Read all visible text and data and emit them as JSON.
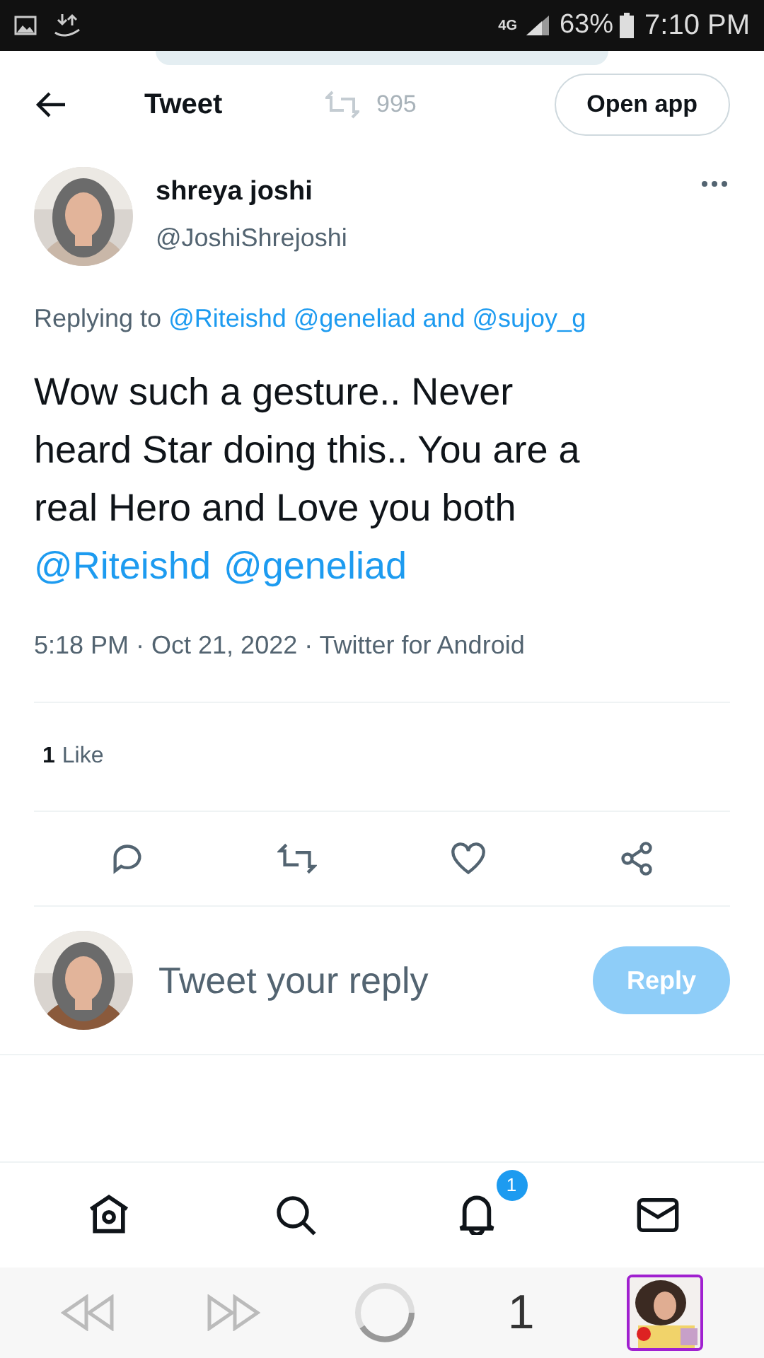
{
  "status_bar": {
    "network": "4G",
    "battery": "63%",
    "time": "7:10 PM"
  },
  "header": {
    "title": "Tweet",
    "faded_count": "995",
    "open_app": "Open app"
  },
  "tweet": {
    "name": "shreya joshi",
    "handle": "@JoshiShrejoshi",
    "replying_label": "Replying to",
    "replying_to": [
      "@Riteishd",
      "@geneliad"
    ],
    "replying_and": "and",
    "replying_last": "@sujoy_g",
    "body": "Wow such a gesture.. Never heard Star doing this.. You are a real Hero and Love you both",
    "mentions": [
      "@Riteishd",
      "@geneliad"
    ],
    "meta": "5:18 PM · Oct 21, 2022 · Twitter for Android",
    "likes_count": "1",
    "likes_label": "Like"
  },
  "reply_box": {
    "placeholder": "Tweet your reply",
    "button": "Reply",
    "disabled": true
  },
  "bottom_nav": {
    "notification_badge": "1"
  },
  "browser_bar": {
    "tab_count": "1"
  }
}
